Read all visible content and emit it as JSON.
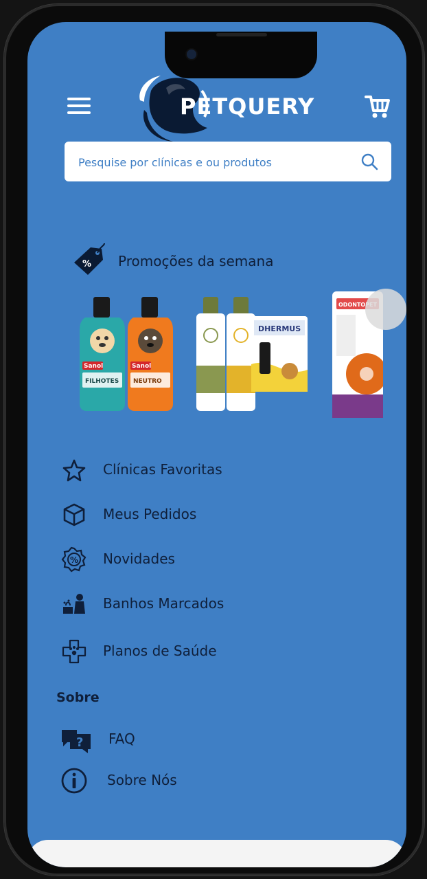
{
  "app": {
    "brand": "PETQUERY"
  },
  "search": {
    "placeholder": "Pesquise por clínicas e ou produtos"
  },
  "promotions": {
    "title": "Promoções da semana",
    "products": [
      {
        "brand": "Sanol",
        "name": "FILHOTES"
      },
      {
        "brand": "Sanol",
        "name": "NEUTRO"
      },
      {
        "name": "Shampoo duo"
      },
      {
        "brand": "DHERMUS"
      },
      {
        "brand": "ODONTOPET"
      }
    ]
  },
  "menu": {
    "items": [
      {
        "label": "Clínicas Favoritas",
        "icon": "star-icon"
      },
      {
        "label": "Meus Pedidos",
        "icon": "box-icon"
      },
      {
        "label": "Novidades",
        "icon": "discount-badge-icon"
      },
      {
        "label": "Banhos Marcados",
        "icon": "pet-bath-icon"
      },
      {
        "label": "Planos de Saúde",
        "icon": "health-plan-icon"
      }
    ]
  },
  "about": {
    "title": "Sobre",
    "items": [
      {
        "label": "FAQ",
        "icon": "faq-chat-icon"
      },
      {
        "label": "Sobre Nós",
        "icon": "info-icon"
      }
    ]
  },
  "colors": {
    "background": "#3f7fc5",
    "text": "#0f1f3a",
    "white": "#ffffff"
  }
}
